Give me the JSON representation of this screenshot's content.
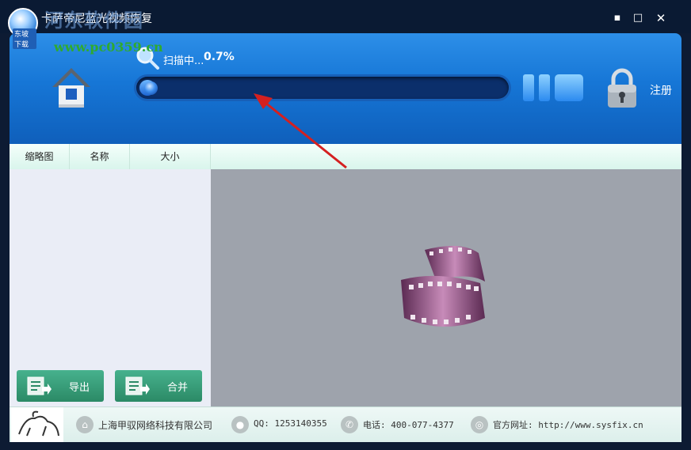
{
  "window": {
    "title": "卡萨帝尼蓝光视频恢复",
    "logo_tag": "东坡下载",
    "minimize_glyph": "▪",
    "maximize_glyph": "□",
    "close_glyph": "✕"
  },
  "watermark": {
    "site_name": "河东软件园",
    "url": "www.pc0359.cn"
  },
  "header": {
    "scan_label": "扫描中...",
    "progress_text": "0.7%",
    "progress_value": 0.007,
    "register_label": "注册",
    "icons": [
      "home-icon",
      "search-icon",
      "pause-icon",
      "stop-icon",
      "lock-icon"
    ]
  },
  "columns": {
    "thumbnail": "缩略图",
    "name": "名称",
    "size": "大小"
  },
  "buttons": {
    "export": "导出",
    "merge": "合并"
  },
  "footer": {
    "company": "上海甲驭网络科技有限公司",
    "qq": "QQ: 1253140355",
    "phone": "电话: 400-077-4377",
    "website": "官方网址: http://www.sysfix.cn"
  },
  "colors": {
    "header_blue": "#1676d6",
    "button_green": "#2b8a66",
    "annotation_red": "#d42020"
  }
}
